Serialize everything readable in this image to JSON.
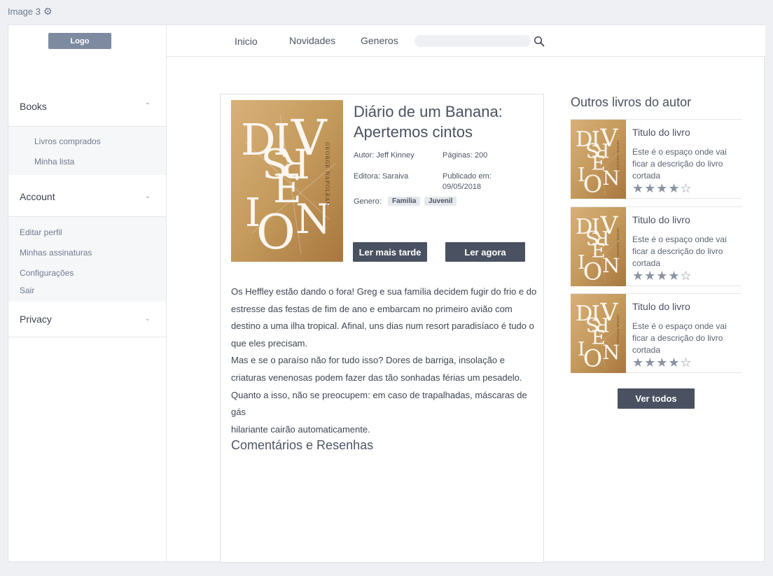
{
  "window_label": "Image 3",
  "sidebar": {
    "logo": "Logo",
    "sections": [
      {
        "title": "Books",
        "items": [
          "Livros comprados",
          "Minha lista"
        ]
      },
      {
        "title": "Account",
        "items": [
          "Editar perfil",
          "Minhas assinaturas",
          "Configurações",
          "Sair"
        ]
      },
      {
        "title": "Privacy",
        "items": []
      }
    ]
  },
  "nav": {
    "links": [
      "Inicio",
      "Novidades",
      "Generos"
    ],
    "search_value": "",
    "search_icon": "search-icon"
  },
  "book": {
    "cover_letters": [
      "D",
      "I",
      "V",
      "S",
      "R",
      "E",
      "I",
      "O",
      "N"
    ],
    "cover_author": "GEORGE NAPOLEAN",
    "title": "Diário de um Banana: Apertemos cintos",
    "author_label": "Autor: Jeff Kinney",
    "pages_label": "Páginas: 200",
    "publisher_label": "Editora: Saraiva",
    "published_label": "Publicado em:",
    "published_date": "09/05/2018",
    "genre_label": "Genero:",
    "genres": [
      "Familia",
      "Juvenil"
    ],
    "btn_later": "Ler mais tarde",
    "btn_now": "Ler agora",
    "description": "Os Heffley estão dando o fora! Greg e sua família decidem fugir do frio e do\nestresse das festas de fim de ano e embarcam no primeiro avião com\ndestino a uma ilha tropical. Afinal, uns dias num resort paradisíaco é tudo o\nque eles precisam.\n Mas e se o paraíso não for tudo isso? Dores de barriga, insolação e\ncriaturas venenosas podem fazer das tão sonhadas férias um pesadelo.\nQuanto a isso, não se preocupem: em caso de trapalhadas, máscaras de gás\nhilariante cairão automaticamente.",
    "comments_title": "Comentários e Resenhas"
  },
  "others": {
    "title": "Outros livros do autor",
    "items": [
      {
        "title": "Titulo do livro",
        "desc": "Este é o espaço onde vai ficar a descrição do livro cortada",
        "rating": 4,
        "max": 5,
        "stars": "★★★★☆"
      },
      {
        "title": "Titulo do livro",
        "desc": "Este é o espaço onde vai ficar a descrição do livro cortada",
        "rating": 4,
        "max": 5,
        "stars": "★★★★☆"
      },
      {
        "title": "Titulo do livro",
        "desc": "Este é o espaço onde vai ficar a descrição do livro cortada",
        "rating": 4,
        "max": 5,
        "stars": "★★★★☆"
      }
    ],
    "see_all": "Ver todos"
  },
  "colors": {
    "accent": "#4a5261",
    "logo_bg": "#7e8aa0",
    "cover_gold": "#c49a5c"
  }
}
